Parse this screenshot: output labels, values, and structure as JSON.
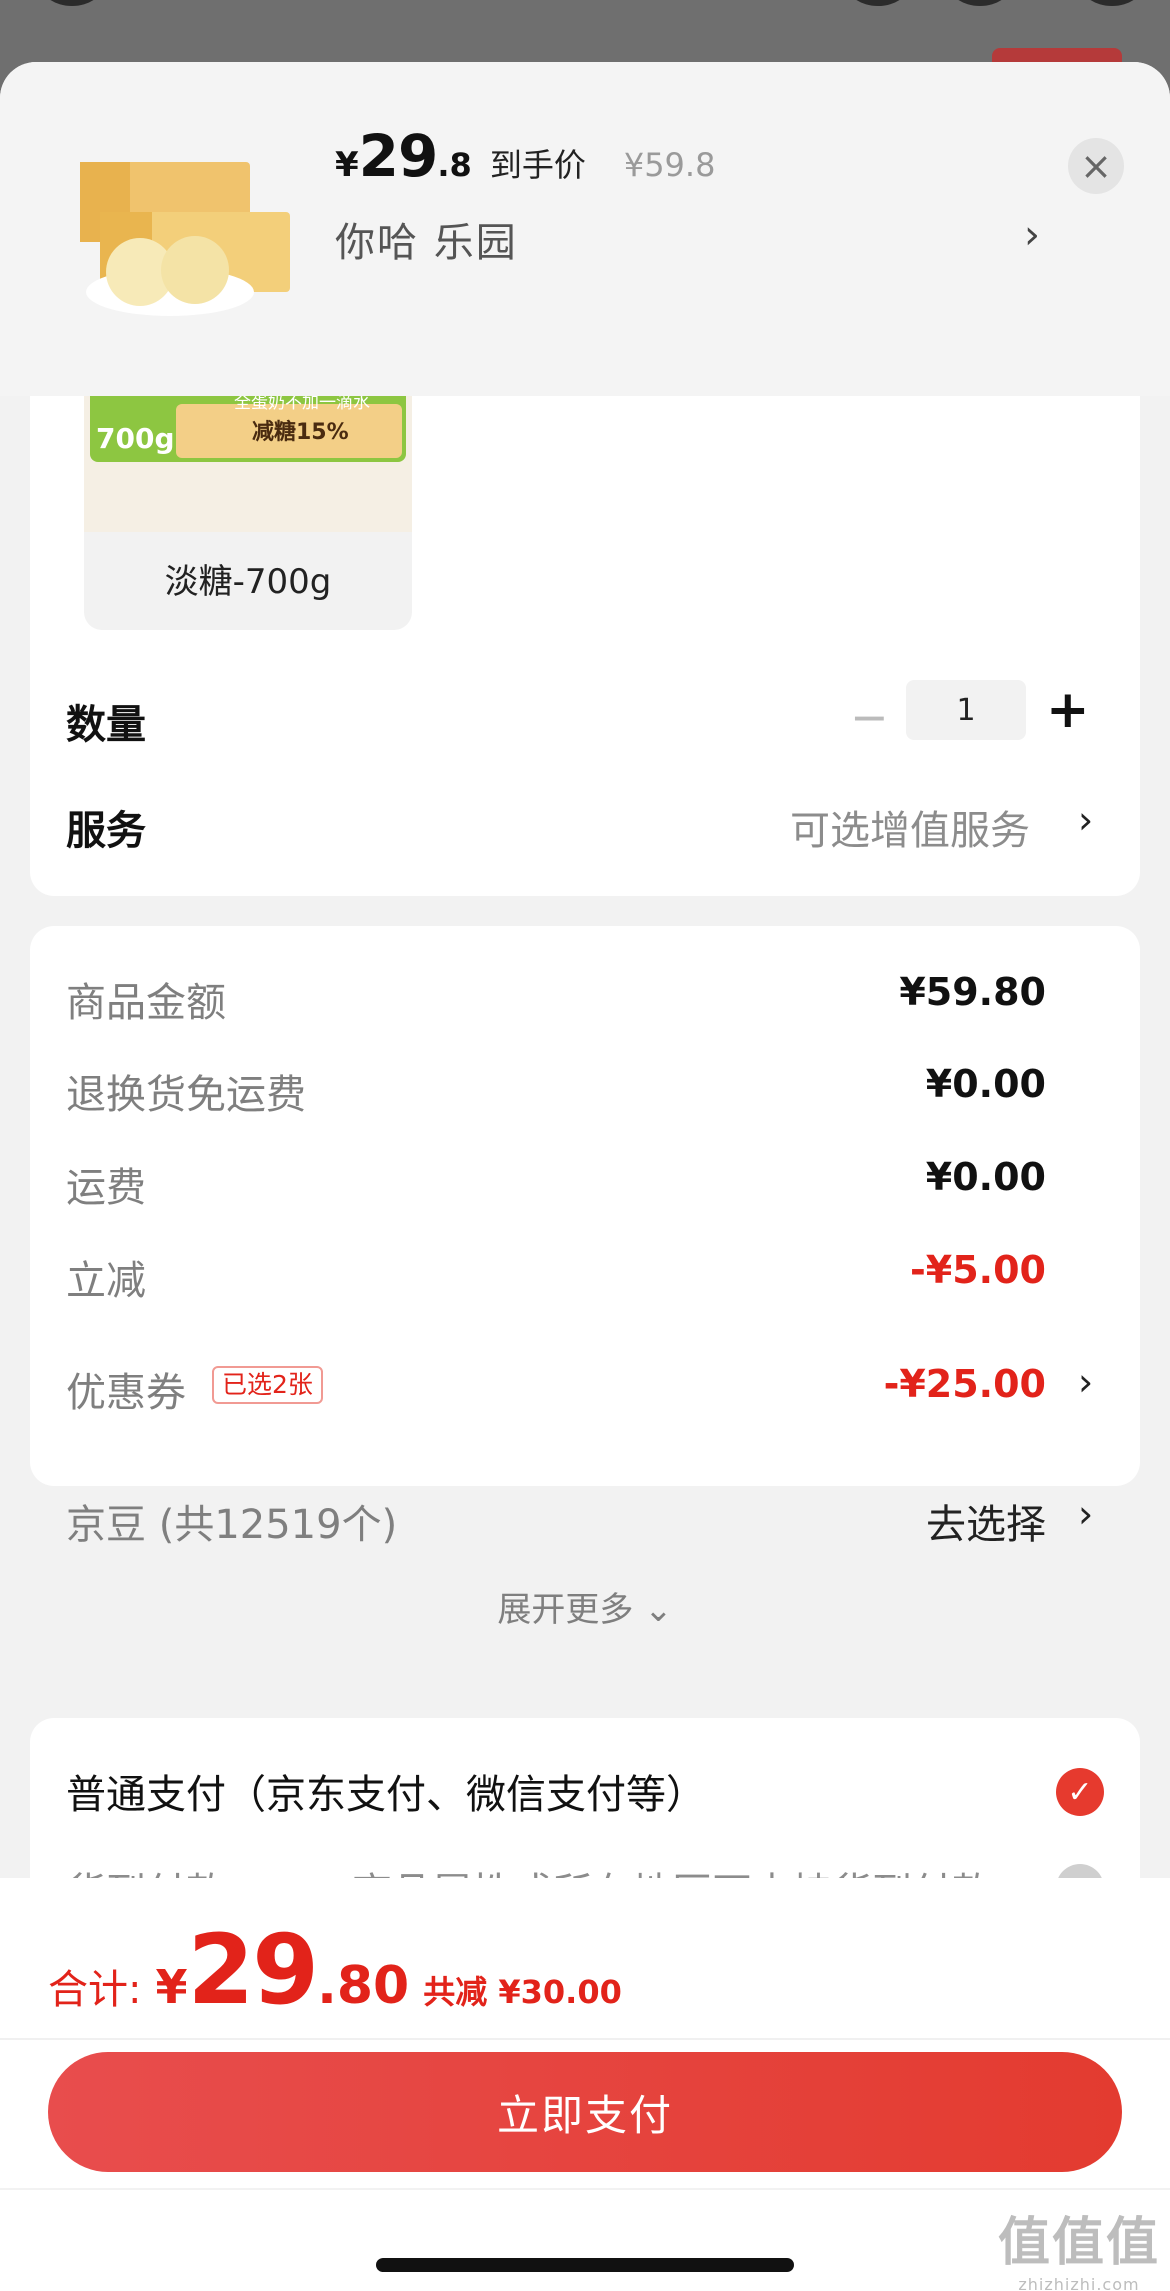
{
  "header": {
    "currency": "¥",
    "price_int": "29",
    "price_dec": ".8",
    "price_tag": "到手价",
    "original_price": "¥59.8",
    "address": "你哈  乐园",
    "arrow": "›",
    "close": "×"
  },
  "sku": {
    "weight_badge": "700g",
    "slogan": "全蛋奶不加一滴水",
    "sugar": "减糖15%",
    "box_text": "淡糖",
    "label": "淡糖-700g"
  },
  "quantity": {
    "label": "数量",
    "minus": "−",
    "value": "1",
    "plus": "+"
  },
  "service": {
    "label": "服务",
    "hint": "可选增值服务",
    "arrow": "›"
  },
  "summary": {
    "rows": [
      {
        "label": "商品金额",
        "value": "¥59.80"
      },
      {
        "label": "退换货免运费",
        "value": "¥0.00"
      },
      {
        "label": "运费",
        "value": "¥0.00"
      },
      {
        "label": "立减",
        "value": "-¥5.00"
      },
      {
        "label": "优惠券",
        "value": "-¥25.00"
      },
      {
        "label": "京豆 (共12519个)",
        "value": "去选择"
      }
    ],
    "coupon_badge": "已选2张",
    "expand": "展开更多 ⌄",
    "arrow": "›"
  },
  "payment": {
    "normal": "普通支付（京东支付、微信支付等）",
    "cod": "货到付款",
    "cod_note": "商品属性或所在地区不支持货到付款",
    "check": "✓",
    "disabled": "−"
  },
  "footer": {
    "total_label": "合计:",
    "currency": "¥",
    "total_int": "29",
    "total_dec": ".80",
    "saving": "共减 ¥30.00",
    "pay_button": "立即支付",
    "watermark": "值值值",
    "watermark_url": "zhizhizhi.com"
  },
  "colors": {
    "accent": "#e2231a",
    "button_gradient_start": "#e84d4d",
    "button_gradient_end": "#e33b30"
  }
}
